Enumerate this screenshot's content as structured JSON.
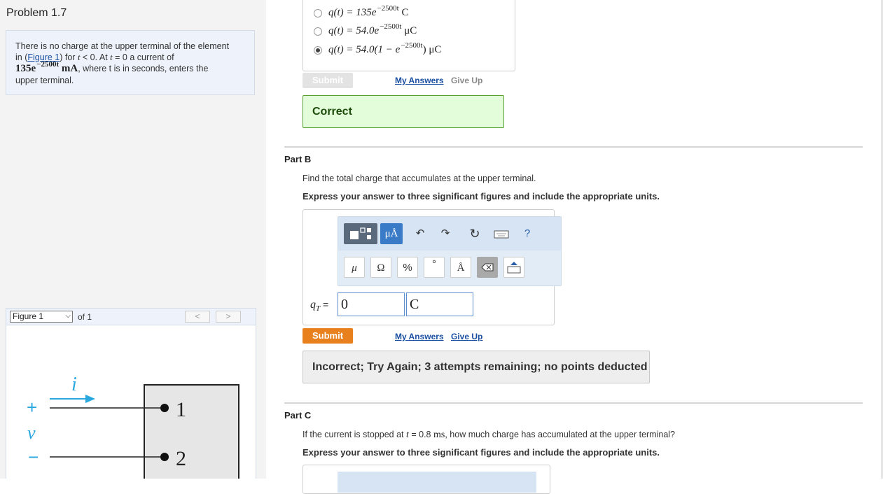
{
  "problem": {
    "title": "Problem 1.7",
    "statement_1": "There is no charge at the upper terminal of the element",
    "statement_2a": "in (",
    "figure_link": "Figure 1",
    "statement_2b": ") for ",
    "t1": "t",
    "statement_2c": " < 0. At ",
    "t2": "t",
    "statement_2d": " = 0 a current of",
    "current_base": "135e",
    "current_exp": "−2500t",
    "current_unit": "mA",
    "statement_3": ", where t is in seconds, enters the",
    "statement_4": "upper terminal."
  },
  "figure": {
    "selected": "Figure 1",
    "of_label": "of 1",
    "prev": "<",
    "next": ">",
    "current_symbol": "i",
    "voltage_symbol": "v",
    "plus": "+",
    "minus": "−",
    "terminal_1": "1",
    "terminal_2": "2"
  },
  "part_a": {
    "choices": [
      {
        "base": "q(t) = 135e",
        "exp": "−2500t",
        "tail": " C",
        "selected": false
      },
      {
        "base": "q(t) = 54.0e",
        "exp": "−2500t",
        "tail": " μC",
        "selected": false
      },
      {
        "base": "q(t) = 54.0(1 − e",
        "exp": "−2500t",
        "tail": ") μC",
        "selected": true
      }
    ],
    "submit": "Submit",
    "my_answers": "My Answers",
    "give_up": "Give Up",
    "feedback": "Correct"
  },
  "part_b": {
    "title": "Part B",
    "question": "Find the total charge that accumulates at the upper terminal.",
    "instruction": "Express your answer to three significant figures and include the appropriate units.",
    "toolbar": {
      "units_btn": "μÅ",
      "help": "?",
      "mu": "μ",
      "omega": "Ω",
      "percent": "%",
      "degree": "°",
      "angstrom": "Å"
    },
    "input_label_var": "q",
    "input_label_sub": "T",
    "input_label_eq": " =",
    "value": "0",
    "units": "C",
    "submit": "Submit",
    "my_answers": "My Answers",
    "give_up": "Give Up",
    "feedback": "Incorrect; Try Again; 3 attempts remaining; no points deducted"
  },
  "part_c": {
    "title": "Part C",
    "question_a": "If the current is stopped at ",
    "question_t": "t",
    "question_b": " = 0.8 ",
    "question_unit": "ms",
    "question_c": ", how much charge has accumulated at the upper terminal?",
    "instruction": "Express your answer to three significant figures and include the appropriate units."
  },
  "colors": {
    "accent_blue": "#1a4fa0",
    "submit_orange": "#e8801d",
    "correct_green": "#e3fcd9",
    "figure_arrow": "#29a8e0"
  }
}
